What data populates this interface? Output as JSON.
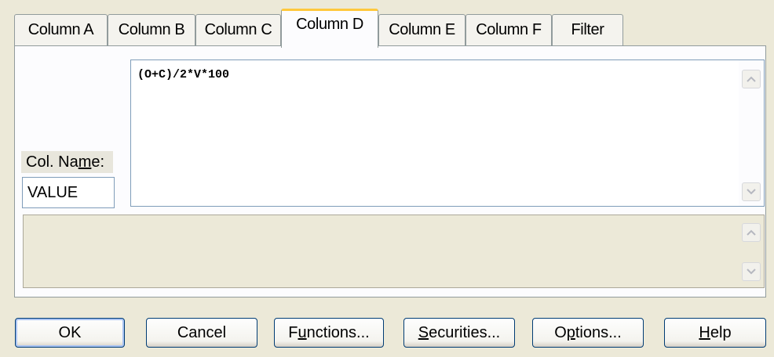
{
  "tabs": [
    {
      "label": "Column A"
    },
    {
      "label": "Column B"
    },
    {
      "label": "Column C"
    },
    {
      "label": "Column D",
      "active": true
    },
    {
      "label": "Column E"
    },
    {
      "label": "Column F"
    },
    {
      "label": "Filter"
    }
  ],
  "column": {
    "name_label_pre": "Col. Na",
    "name_label_mnemonic": "m",
    "name_label_post": "e:",
    "name_value": "VALUE",
    "formula": "(O+C)/2*V*100"
  },
  "buttons": {
    "ok": "OK",
    "cancel": "Cancel",
    "functions_pre": "F",
    "functions_mn": "u",
    "functions_post": "nctions...",
    "securities_pre": "",
    "securities_mn": "S",
    "securities_post": "ecurities...",
    "options_pre": "O",
    "options_mn": "p",
    "options_post": "tions...",
    "help_pre": "",
    "help_mn": "H",
    "help_post": "elp"
  },
  "icons": {
    "scroll_up": "chevron-up-icon",
    "scroll_down": "chevron-down-icon"
  },
  "colors": {
    "active_tab_accent": "#ffc83c",
    "dialog_bg": "#ece9d8",
    "button_border": "#003c74"
  }
}
